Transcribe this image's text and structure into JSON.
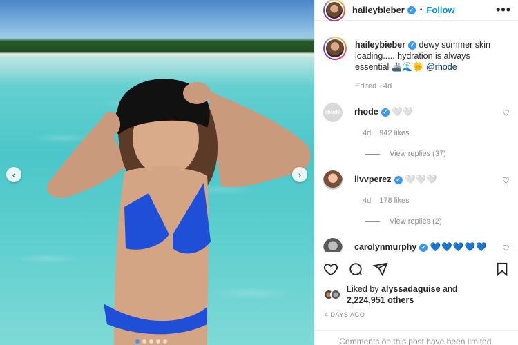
{
  "post": {
    "username": "haileybieber",
    "follow_label": "Follow",
    "separator": "•",
    "more_label": "•••",
    "caption_text": "dewy summer skin loading..... hydration is always essential 🚢🌊🌞",
    "caption_mention": "@rhode",
    "edited": "Edited · 4d",
    "carousel_prev": "‹",
    "carousel_next": "›"
  },
  "comments": [
    {
      "username": "rhode",
      "text": "🤍🤍",
      "time": "4d",
      "likes": "942 likes",
      "replies": "View replies (37)",
      "avatar_label": "rhode"
    },
    {
      "username": "livvperez",
      "text": "🤍🤍🤍",
      "time": "4d",
      "likes": "178 likes",
      "replies": "View replies (2)"
    },
    {
      "username": "carolynmurphy",
      "text": "💙💙💙💙💙"
    }
  ],
  "footer": {
    "liked_by_prefix": "Liked by",
    "liked_by_user": "alyssadaguise",
    "liked_by_and": "and",
    "others": "2,224,951 others",
    "date": "4 DAYS AGO",
    "limited": "Comments on this post have been limited."
  },
  "icons": [
    "heart-icon",
    "comment-icon",
    "share-icon",
    "bookmark-icon",
    "chevron-left-icon",
    "chevron-right-icon",
    "more-icon",
    "verified-icon"
  ],
  "colors": {
    "accent": "#0095f6",
    "verified": "#3897f0",
    "muted": "#8e8e8e"
  }
}
